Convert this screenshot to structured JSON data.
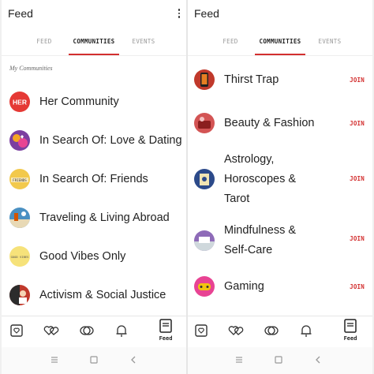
{
  "left": {
    "app_title": "Feed",
    "tabs": [
      {
        "label": "FEED",
        "active": false
      },
      {
        "label": "COMMUNITIES",
        "active": true
      },
      {
        "label": "EVENTS",
        "active": false
      }
    ],
    "section_title": "My Communities",
    "communities": [
      {
        "name": "Her Community",
        "avatar_text": "HER",
        "avatar_color": "#e53935"
      },
      {
        "name": "In Search Of: Love & Dating",
        "avatar_color": "#7b3fa0"
      },
      {
        "name": "In Search Of: Friends",
        "avatar_text": "FRIENDS",
        "avatar_color": "#f2c94c"
      },
      {
        "name": "Traveling & Living Abroad",
        "avatar_color": "#4a90c2"
      },
      {
        "name": "Good Vibes Only",
        "avatar_text": "GOOD VIBES",
        "avatar_color": "#f6e27a"
      },
      {
        "name": "Activism & Social Justice",
        "avatar_color": "#c0392b"
      }
    ],
    "bottom_nav": [
      {
        "icon": "communities-icon"
      },
      {
        "icon": "hearts-icon"
      },
      {
        "icon": "chat-bubbles-icon"
      },
      {
        "icon": "bell-icon"
      },
      {
        "icon": "feed-icon",
        "label": "Feed",
        "active": true
      }
    ]
  },
  "right": {
    "app_title": "Feed",
    "tabs": [
      {
        "label": "FEED",
        "active": false
      },
      {
        "label": "COMMUNITIES",
        "active": true
      },
      {
        "label": "EVENTS",
        "active": false
      }
    ],
    "suggestions": [
      {
        "name_lines": [
          "Thirst Trap"
        ],
        "join_label": "JOIN",
        "avatar_color": "#c0392b"
      },
      {
        "name_lines": [
          "Beauty & Fashion"
        ],
        "join_label": "JOIN",
        "avatar_color": "#d35454"
      },
      {
        "name_lines": [
          "Astrology,",
          "Horoscopes &",
          "Tarot"
        ],
        "join_label": "JOIN",
        "avatar_color": "#2c4a8a"
      },
      {
        "name_lines": [
          "Mindfulness &",
          "Self-Care"
        ],
        "join_label": "JOIN",
        "avatar_color": "#8e6bb8"
      },
      {
        "name_lines": [
          "Gaming"
        ],
        "join_label": "JOIN",
        "avatar_color": "#e84393"
      }
    ],
    "bottom_nav": [
      {
        "icon": "communities-icon"
      },
      {
        "icon": "hearts-icon"
      },
      {
        "icon": "chat-bubbles-icon"
      },
      {
        "icon": "bell-icon"
      },
      {
        "icon": "feed-icon",
        "label": "Feed",
        "active": true
      }
    ]
  },
  "colors": {
    "accent": "#d32f2f",
    "text": "#222222",
    "muted": "#999999"
  }
}
